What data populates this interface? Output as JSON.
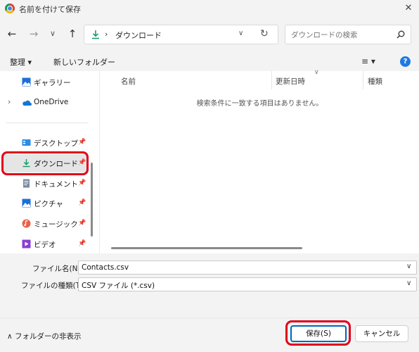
{
  "window": {
    "title": "名前を付けて保存",
    "close_icon": "✕"
  },
  "nav": {
    "back_glyph": "←",
    "forward_glyph": "→",
    "history_glyph": "∨",
    "up_glyph": "↑",
    "address": {
      "separator": "›",
      "location": "ダウンロード",
      "dropdown_glyph": "∨",
      "refresh_glyph": "↻"
    },
    "search": {
      "placeholder": "ダウンロードの検索"
    }
  },
  "toolbar": {
    "organize_label": "整理 ▾",
    "new_folder_label": "新しいフォルダー",
    "view_label": "≡ ▾",
    "help_label": "?"
  },
  "sidebar": {
    "items": [
      {
        "label": "ギャラリー",
        "icon": "gallery-icon"
      },
      {
        "label": "OneDrive",
        "icon": "onedrive-icon",
        "expand_glyph": "›"
      },
      {
        "label": "デスクトップ",
        "icon": "desktop-icon",
        "pinned": true
      },
      {
        "label": "ダウンロード",
        "icon": "download-icon",
        "pinned": true,
        "selected": true
      },
      {
        "label": "ドキュメント",
        "icon": "documents-icon",
        "pinned": true
      },
      {
        "label": "ピクチャ",
        "icon": "pictures-icon",
        "pinned": true
      },
      {
        "label": "ミュージック",
        "icon": "music-icon",
        "pinned": true
      },
      {
        "label": "ビデオ",
        "icon": "videos-icon",
        "pinned": true
      }
    ],
    "pin_glyph": "📌"
  },
  "filelist": {
    "columns": [
      "名前",
      "更新日時",
      "種類"
    ],
    "sort_glyph": "∨",
    "empty_message": "検索条件に一致する項目はありません。"
  },
  "form": {
    "filename_label": "ファイル名(N):",
    "filename_value": "Contacts.csv",
    "filetype_label": "ファイルの種類(T):",
    "filetype_value": "CSV ファイル (*.csv)",
    "dropdown_glyph": "∨"
  },
  "footer": {
    "hide_folders_label": "∧  フォルダーの非表示",
    "save_label": "保存(S)",
    "cancel_label": "キャンセル"
  },
  "colors": {
    "accent": "#0067c0",
    "highlight": "#e0001b",
    "download_green": "#1a9d6b"
  }
}
